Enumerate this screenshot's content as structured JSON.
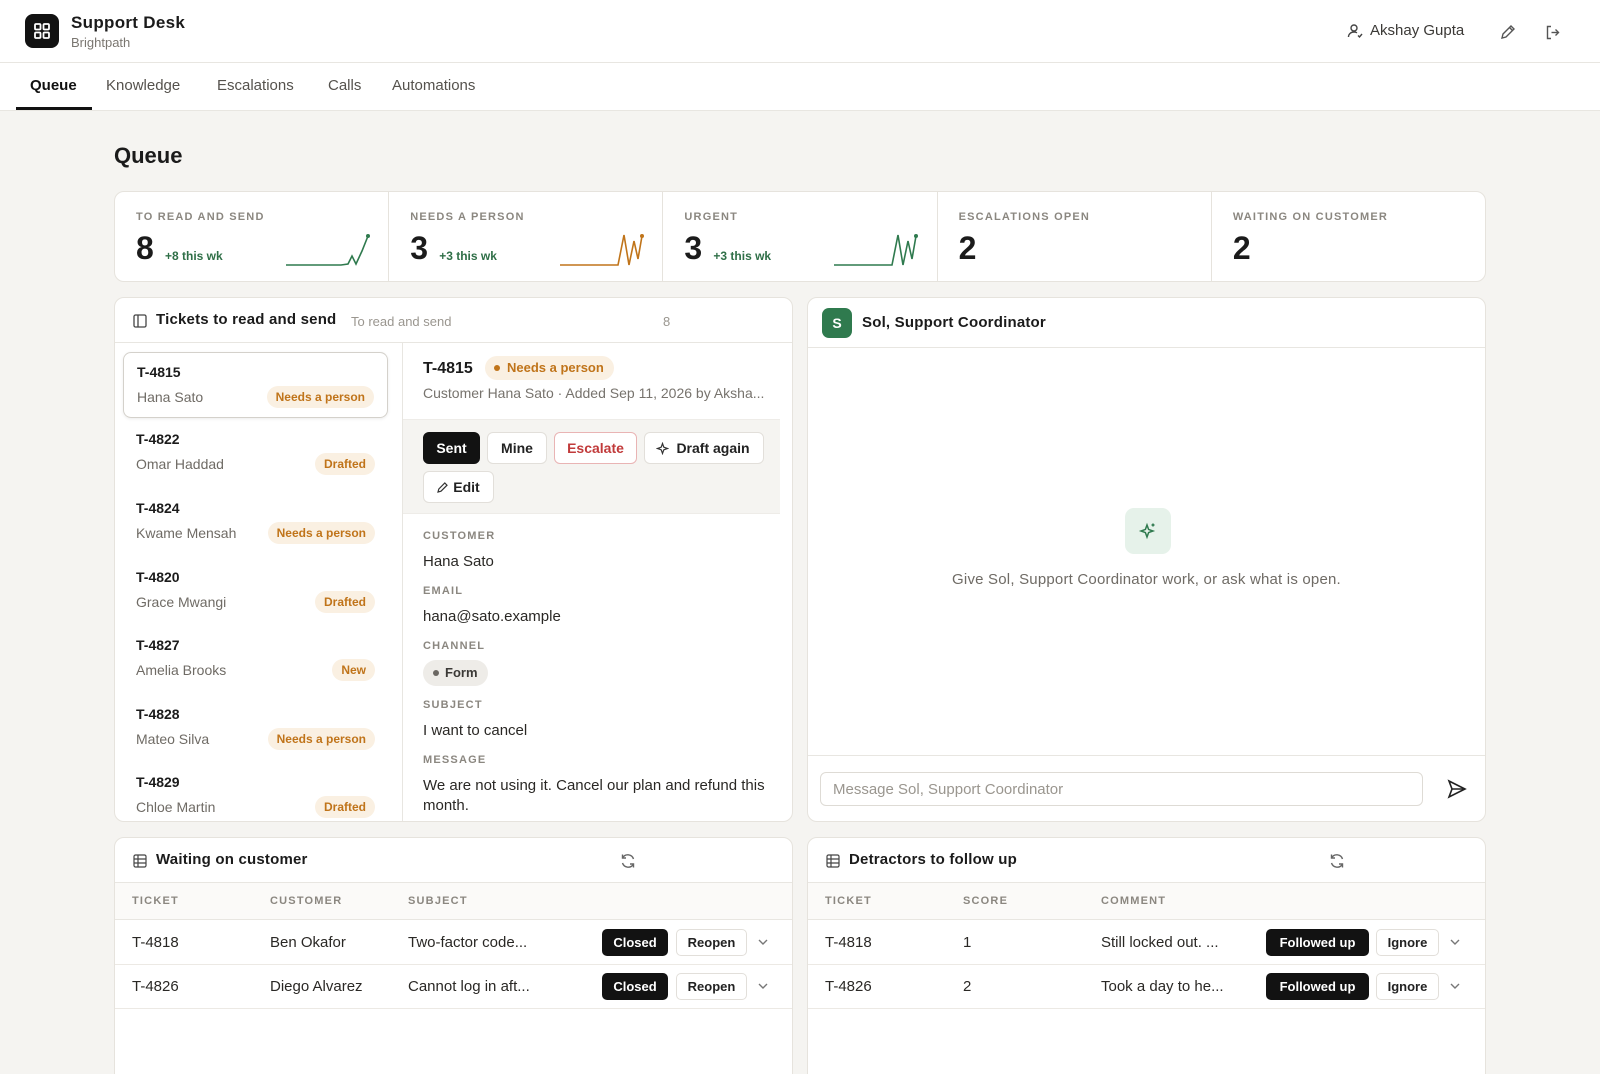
{
  "app": {
    "title": "Support Desk",
    "subtitle": "Brightpath"
  },
  "user": {
    "name": "Akshay Gupta"
  },
  "nav": {
    "tabs": [
      "Queue",
      "Knowledge",
      "Escalations",
      "Calls",
      "Automations"
    ],
    "active": "Queue"
  },
  "page": {
    "title": "Queue"
  },
  "stats": [
    {
      "label": "TO READ AND SEND",
      "value": "8",
      "delta": "+8 this wk"
    },
    {
      "label": "NEEDS A PERSON",
      "value": "3",
      "delta": "+3 this wk"
    },
    {
      "label": "URGENT",
      "value": "3",
      "delta": "+3 this wk"
    },
    {
      "label": "ESCALATIONS OPEN",
      "value": "2"
    },
    {
      "label": "WAITING ON CUSTOMER",
      "value": "2"
    }
  ],
  "tickets_panel": {
    "title": "Tickets to read and send",
    "subtitle": "To read and send",
    "count": "8",
    "items": [
      {
        "id": "T-4815",
        "name": "Hana Sato",
        "status": "Needs a person"
      },
      {
        "id": "T-4822",
        "name": "Omar Haddad",
        "status": "Drafted"
      },
      {
        "id": "T-4824",
        "name": "Kwame Mensah",
        "status": "Needs a person"
      },
      {
        "id": "T-4820",
        "name": "Grace Mwangi",
        "status": "Drafted"
      },
      {
        "id": "T-4827",
        "name": "Amelia Brooks",
        "status": "New"
      },
      {
        "id": "T-4828",
        "name": "Mateo Silva",
        "status": "Needs a person"
      },
      {
        "id": "T-4829",
        "name": "Chloe Martin",
        "status": "Drafted"
      }
    ]
  },
  "detail": {
    "id": "T-4815",
    "status": "Needs a person",
    "meta": "Customer Hana Sato  ·  Added Sep 11, 2026 by Aksha...",
    "actions": {
      "sent": "Sent",
      "mine": "Mine",
      "escalate": "Escalate",
      "draft_again": "Draft again",
      "edit": "Edit"
    },
    "fields": {
      "customer_label": "CUSTOMER",
      "customer": "Hana Sato",
      "email_label": "EMAIL",
      "email": "hana@sato.example",
      "channel_label": "CHANNEL",
      "channel": "Form",
      "subject_label": "SUBJECT",
      "subject": "I want to cancel",
      "message_label": "MESSAGE",
      "message": "We are not using it. Cancel our plan and refund this month."
    }
  },
  "chat": {
    "avatar": "S",
    "title": "Sol, Support Coordinator",
    "empty_text": "Give Sol, Support Coordinator work, or ask what is open.",
    "input_placeholder": "Message Sol, Support Coordinator"
  },
  "waiting": {
    "title": "Waiting on customer",
    "columns": [
      "TICKET",
      "CUSTOMER",
      "SUBJECT"
    ],
    "rows": [
      {
        "ticket": "T-4818",
        "customer": "Ben Okafor",
        "subject": "Two-factor code...",
        "primary": "Closed",
        "secondary": "Reopen"
      },
      {
        "ticket": "T-4826",
        "customer": "Diego Alvarez",
        "subject": "Cannot log in aft...",
        "primary": "Closed",
        "secondary": "Reopen"
      }
    ]
  },
  "detractors": {
    "title": "Detractors to follow up",
    "columns": [
      "TICKET",
      "SCORE",
      "COMMENT"
    ],
    "rows": [
      {
        "ticket": "T-4818",
        "score": "1",
        "comment": "Still locked out. ...",
        "primary": "Followed up",
        "secondary": "Ignore"
      },
      {
        "ticket": "T-4826",
        "score": "2",
        "comment": "Took a day to he...",
        "primary": "Followed up",
        "secondary": "Ignore"
      }
    ]
  },
  "colors": {
    "accent_green": "#2f7a4e",
    "warn_orange": "#c0741a",
    "danger_red": "#c13a3a"
  }
}
